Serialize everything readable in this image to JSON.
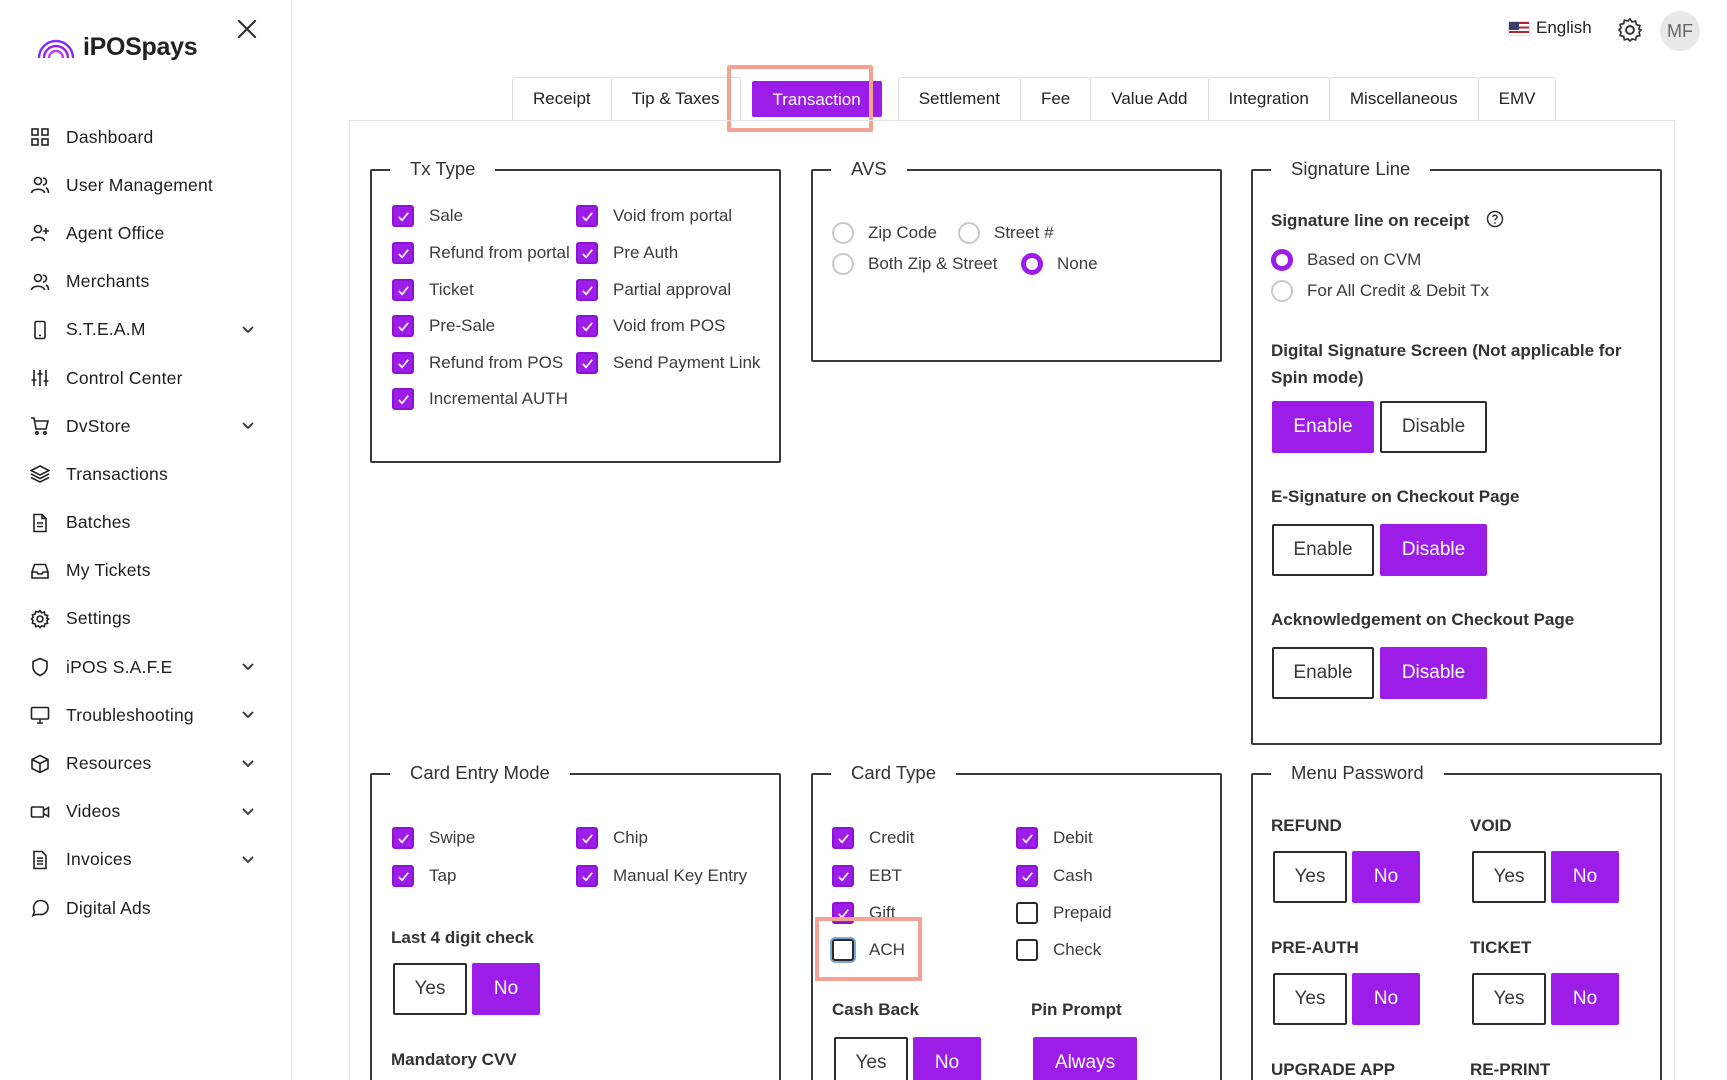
{
  "app": {
    "name": "iPOSpays",
    "brand_color": "#9d1de8"
  },
  "sidebar": {
    "items": [
      {
        "label": "Dashboard",
        "icon": "grid-icon",
        "expandable": false
      },
      {
        "label": "User Management",
        "icon": "users-icon",
        "expandable": false
      },
      {
        "label": "Agent Office",
        "icon": "user-plus-icon",
        "expandable": false
      },
      {
        "label": "Merchants",
        "icon": "users-icon",
        "expandable": false
      },
      {
        "label": "S.T.E.A.M",
        "icon": "device-icon",
        "expandable": true
      },
      {
        "label": "Control Center",
        "icon": "sliders-icon",
        "expandable": false
      },
      {
        "label": "DvStore",
        "icon": "cart-icon",
        "expandable": true
      },
      {
        "label": "Transactions",
        "icon": "layers-icon",
        "expandable": false
      },
      {
        "label": "Batches",
        "icon": "file-icon",
        "expandable": false
      },
      {
        "label": "My Tickets",
        "icon": "inbox-icon",
        "expandable": false
      },
      {
        "label": "Settings",
        "icon": "gear-icon",
        "expandable": false
      },
      {
        "label": "iPOS S.A.F.E",
        "icon": "shield-icon",
        "expandable": true
      },
      {
        "label": "Troubleshooting",
        "icon": "monitor-icon",
        "expandable": true
      },
      {
        "label": "Resources",
        "icon": "box-icon",
        "expandable": true
      },
      {
        "label": "Videos",
        "icon": "video-icon",
        "expandable": true
      },
      {
        "label": "Invoices",
        "icon": "document-icon",
        "expandable": true
      },
      {
        "label": "Digital Ads",
        "icon": "message-icon",
        "expandable": false
      }
    ]
  },
  "header": {
    "language": "English",
    "avatar_initials": "MF"
  },
  "tabs": [
    "Receipt",
    "Tip & Taxes",
    "Transaction",
    "Settlement",
    "Fee",
    "Value Add",
    "Integration",
    "Miscellaneous",
    "EMV"
  ],
  "active_tab": "Transaction",
  "tx_type": {
    "title": "Tx Type",
    "left": [
      {
        "label": "Sale",
        "checked": true
      },
      {
        "label": "Refund from portal",
        "checked": true
      },
      {
        "label": "Ticket",
        "checked": true
      },
      {
        "label": "Pre-Sale",
        "checked": true
      },
      {
        "label": "Refund from POS",
        "checked": true
      },
      {
        "label": "Incremental AUTH",
        "checked": true
      }
    ],
    "right": [
      {
        "label": "Void from portal",
        "checked": true
      },
      {
        "label": "Pre Auth",
        "checked": true
      },
      {
        "label": "Partial approval",
        "checked": true
      },
      {
        "label": "Void from POS",
        "checked": true
      },
      {
        "label": "Send Payment Link",
        "checked": true
      }
    ]
  },
  "avs": {
    "title": "AVS",
    "options": [
      {
        "label": "Zip Code",
        "selected": false
      },
      {
        "label": "Street #",
        "selected": false
      },
      {
        "label": "Both Zip & Street",
        "selected": false
      },
      {
        "label": "None",
        "selected": true
      }
    ]
  },
  "signature_line": {
    "title": "Signature Line",
    "on_receipt_label": "Signature line on receipt",
    "options": [
      {
        "label": "Based on CVM",
        "selected": true
      },
      {
        "label": "For All Credit & Debit Tx",
        "selected": false
      }
    ],
    "digital_label_line1": "Digital Signature Screen (Not applicable for",
    "digital_label_line2": "Spin mode)",
    "digital_enable": "Enable",
    "digital_disable": "Disable",
    "digital_value": "Enable",
    "esig_label": "E-Signature on Checkout Page",
    "esig_enable": "Enable",
    "esig_disable": "Disable",
    "esig_value": "Disable",
    "ack_label": "Acknowledgement on Checkout Page",
    "ack_enable": "Enable",
    "ack_disable": "Disable",
    "ack_value": "Disable"
  },
  "card_entry": {
    "title": "Card Entry Mode",
    "left": [
      {
        "label": "Swipe",
        "checked": true
      },
      {
        "label": "Tap",
        "checked": true
      }
    ],
    "right": [
      {
        "label": "Chip",
        "checked": true
      },
      {
        "label": "Manual Key Entry",
        "checked": true
      }
    ],
    "last4_label": "Last 4 digit check",
    "last4_yes": "Yes",
    "last4_no": "No",
    "last4_value": "No",
    "cvv_label": "Mandatory CVV"
  },
  "card_type": {
    "title": "Card Type",
    "left": [
      {
        "label": "Credit",
        "checked": true
      },
      {
        "label": "EBT",
        "checked": true
      },
      {
        "label": "Gift",
        "checked": true
      },
      {
        "label": "ACH",
        "checked": false
      }
    ],
    "right": [
      {
        "label": "Debit",
        "checked": true
      },
      {
        "label": "Cash",
        "checked": true
      },
      {
        "label": "Prepaid",
        "checked": false
      },
      {
        "label": "Check",
        "checked": false
      }
    ],
    "cashback_label": "Cash Back",
    "cashback_yes": "Yes",
    "cashback_no": "No",
    "cashback_value": "No",
    "pin_label": "Pin Prompt",
    "pin_value": "Always"
  },
  "menu_password": {
    "title": "Menu Password",
    "refund_label": "REFUND",
    "void_label": "VOID",
    "preauth_label": "PRE-AUTH",
    "ticket_label": "TICKET",
    "upgrade_label": "UPGRADE APP",
    "reprint_label": "RE-PRINT",
    "yes": "Yes",
    "no": "No",
    "refund_value": "No",
    "void_value": "No",
    "preauth_value": "No",
    "ticket_value": "No"
  }
}
